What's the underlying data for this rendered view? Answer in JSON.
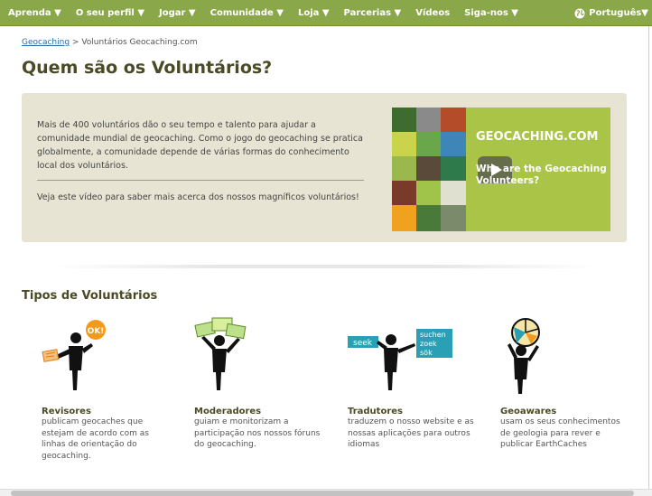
{
  "nav": {
    "items": [
      "Aprenda ▼",
      "O seu perfil ▼",
      "Jogar ▼",
      "Comunidade ▼",
      "Loja ▼",
      "Parcerias ▼",
      "Vídeos",
      "Siga-nos ▼"
    ],
    "language": "Português▼"
  },
  "breadcrumb": {
    "link": "Geocaching",
    "separator": " > ",
    "current": "Voluntários Geocaching.com"
  },
  "page_title": "Quem são os Voluntários?",
  "intro": {
    "paragraph": "Mais de 400 voluntários dão o seu tempo e talento para ajudar a comunidade mundial de geocaching. Como o jogo do geocaching se pratica globalmente, a comunidade depende de várias formas do conhecimento local dos voluntários.",
    "cta": "Veja este vídeo para saber mais acerca dos nossos magníficos voluntários!"
  },
  "video": {
    "brand": "GEOCACHING.COM",
    "title": "Who are the Geocaching Volunteers?"
  },
  "section_title": "Tipos de Voluntários",
  "volunteers": [
    {
      "name": "Revisores",
      "desc": "publicam geocaches que estejam de acordo com as linhas de orientação do geocaching.",
      "badge": "OK!"
    },
    {
      "name": "Moderadores",
      "desc": "guiam e monitorizam a participação nos nossos fóruns do geocaching."
    },
    {
      "name": "Tradutores",
      "desc": "traduzem o nosso website e as nossas aplicações para outros idiomas",
      "words": [
        "seek",
        "suchen",
        "zoek",
        "sök"
      ]
    },
    {
      "name": "Geoawares",
      "desc": "usam os seus conhecimentos de geologia para rever e publicar EarthCaches"
    }
  ],
  "colors": {
    "nav": "#8aa84a",
    "panel": "#e8e4d3",
    "heading": "#4a4a26",
    "link": "#2a6aa8",
    "accent_orange": "#f39a1e",
    "accent_teal": "#2aa0b6"
  }
}
